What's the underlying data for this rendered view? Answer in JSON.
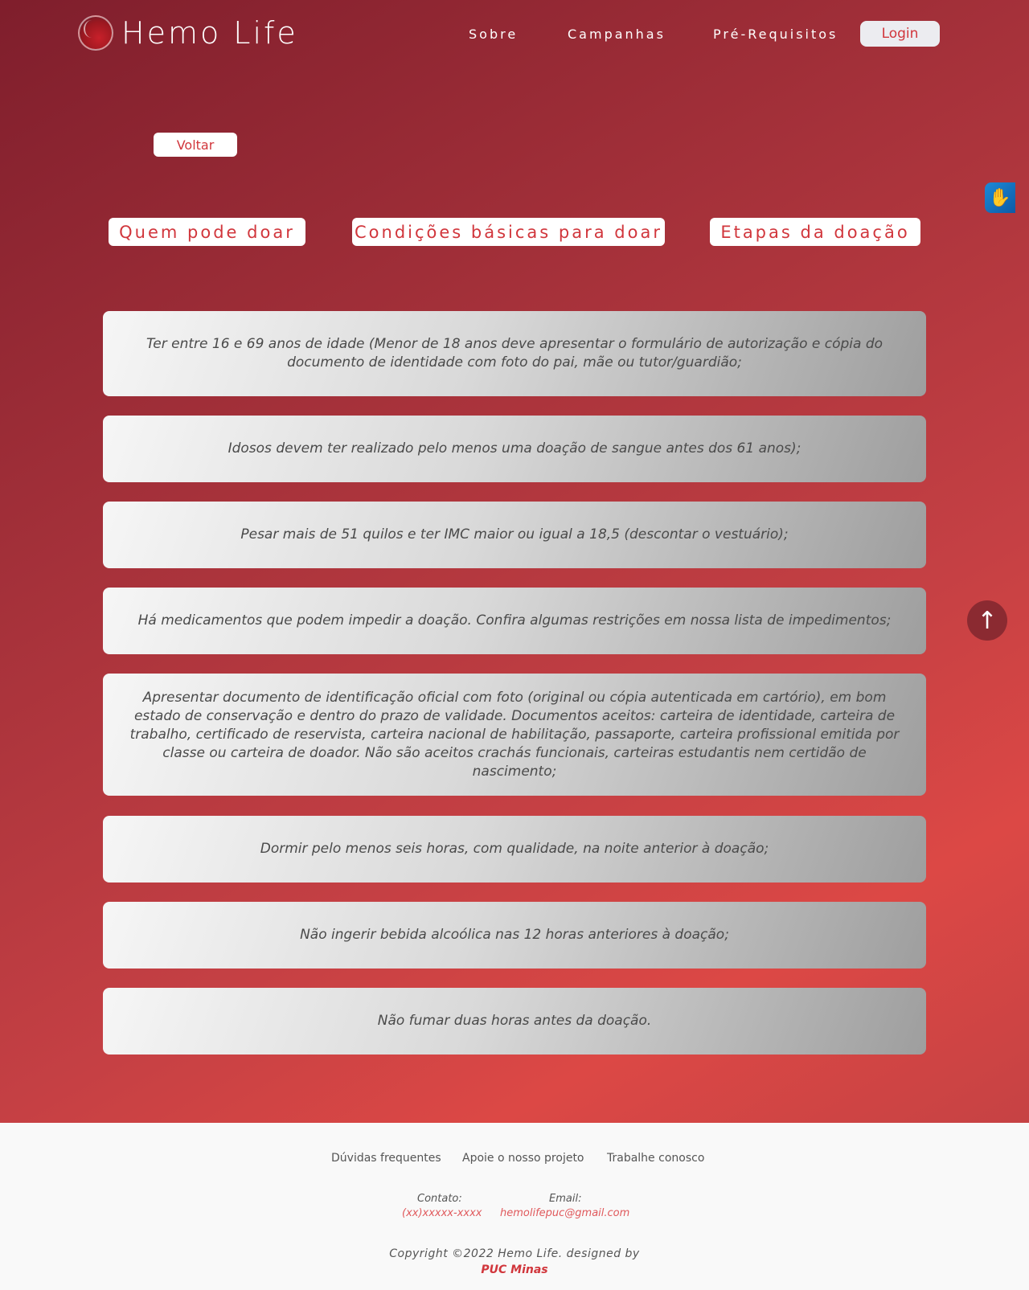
{
  "header": {
    "brand": "Hemo Life",
    "nav": [
      "Sobre",
      "Campanhas",
      "Pré-Requisitos"
    ],
    "login_label": "Login"
  },
  "back_label": "Voltar",
  "tabs": [
    "Quem pode doar",
    "Condições básicas para doar",
    "Etapas da doação"
  ],
  "requirements": [
    "Ter entre 16 e 69 anos de idade (Menor de 18 anos deve apresentar o formulário de autorização e cópia do documento de identidade com foto do pai, mãe ou tutor/guardião;",
    "Idosos devem ter realizado pelo menos uma doação de sangue antes dos 61 anos);",
    "Pesar mais de 51 quilos e ter IMC maior ou igual a 18,5 (descontar o vestuário);",
    "Há medicamentos que podem impedir a doação. Confira algumas restrições em nossa lista de impedimentos;",
    "Apresentar documento de identificação oficial com foto (original ou cópia autenticada em cartório), em bom estado de conservação e dentro do prazo de validade. Documentos aceitos: carteira de identidade, carteira de trabalho, certificado de reservista, carteira nacional de habilitação, passaporte, carteira profissional emitida por classe ou carteira de doador. Não são aceitos crachás funcionais, carteiras estudantis nem certidão de nascimento;",
    "Dormir pelo menos seis horas, com qualidade, na noite anterior à doação;",
    "Não ingerir bebida alcoólica nas 12 horas anteriores à doação;",
    "Não fumar duas horas antes da doação."
  ],
  "floating": {
    "accessibility_icon": "sign-language-icon",
    "scroll_top_icon": "arrow-up-icon"
  },
  "footer": {
    "links": [
      "Dúvidas frequentes",
      "Apoie o nosso projeto",
      "Trabalhe conosco"
    ],
    "contact_label": "Contato:",
    "contact_value": "(xx)xxxxx-xxxx",
    "email_label": "Email:",
    "email_value": "hemolifepuc@gmail.com",
    "copyright": "Copyright ©2022 Hemo Life. designed by",
    "credit": "PUC Minas"
  },
  "colors": {
    "accent": "#d1363c",
    "hero_dark": "#7f1e2c",
    "hero_light": "#dc4845"
  }
}
